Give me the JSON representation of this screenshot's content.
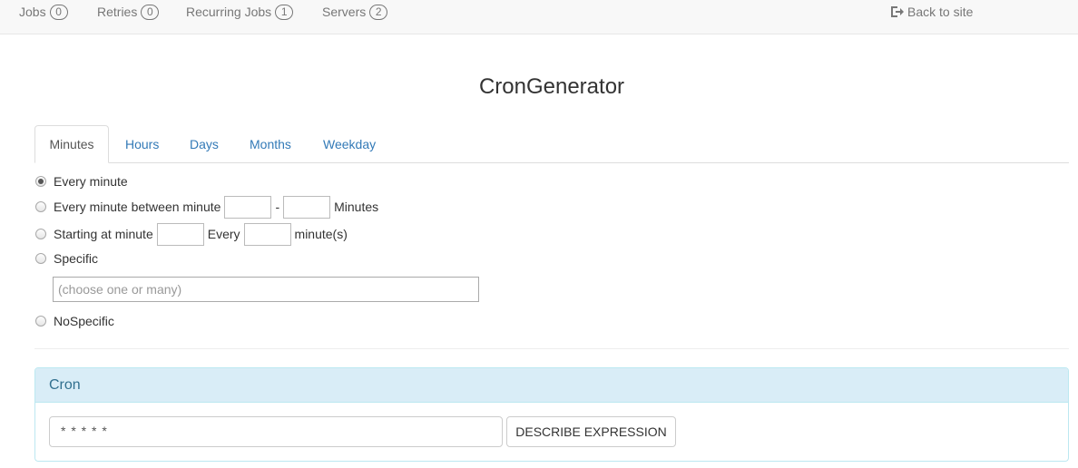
{
  "nav": {
    "items": [
      {
        "label": "Jobs",
        "count": "0"
      },
      {
        "label": "Retries",
        "count": "0"
      },
      {
        "label": "Recurring Jobs",
        "count": "1"
      },
      {
        "label": "Servers",
        "count": "2"
      }
    ],
    "back_label": "Back to site",
    "back_icon": "sign-out-icon"
  },
  "title": "CronGenerator",
  "tabs": [
    "Minutes",
    "Hours",
    "Days",
    "Months",
    "Weekday"
  ],
  "active_tab": "Minutes",
  "options": {
    "every_minute": "Every minute",
    "between_label": "Every minute between minute",
    "between_dash": "-",
    "between_suffix": "Minutes",
    "starting_label": "Starting at minute",
    "starting_every": "Every",
    "starting_suffix": "minute(s)",
    "specific": "Specific",
    "specific_placeholder": "(choose one or many)",
    "nospecific": "NoSpecific"
  },
  "selected_option": "every_minute",
  "cron_panel": {
    "heading": "Cron",
    "expression": "* * * * *",
    "describe_button": "DESCRIBE EXPRESSION"
  },
  "colors": {
    "link": "#337ab7",
    "panel_heading_bg": "#d9edf7",
    "panel_heading_text": "#31708f",
    "panel_border": "#bce8f1"
  }
}
